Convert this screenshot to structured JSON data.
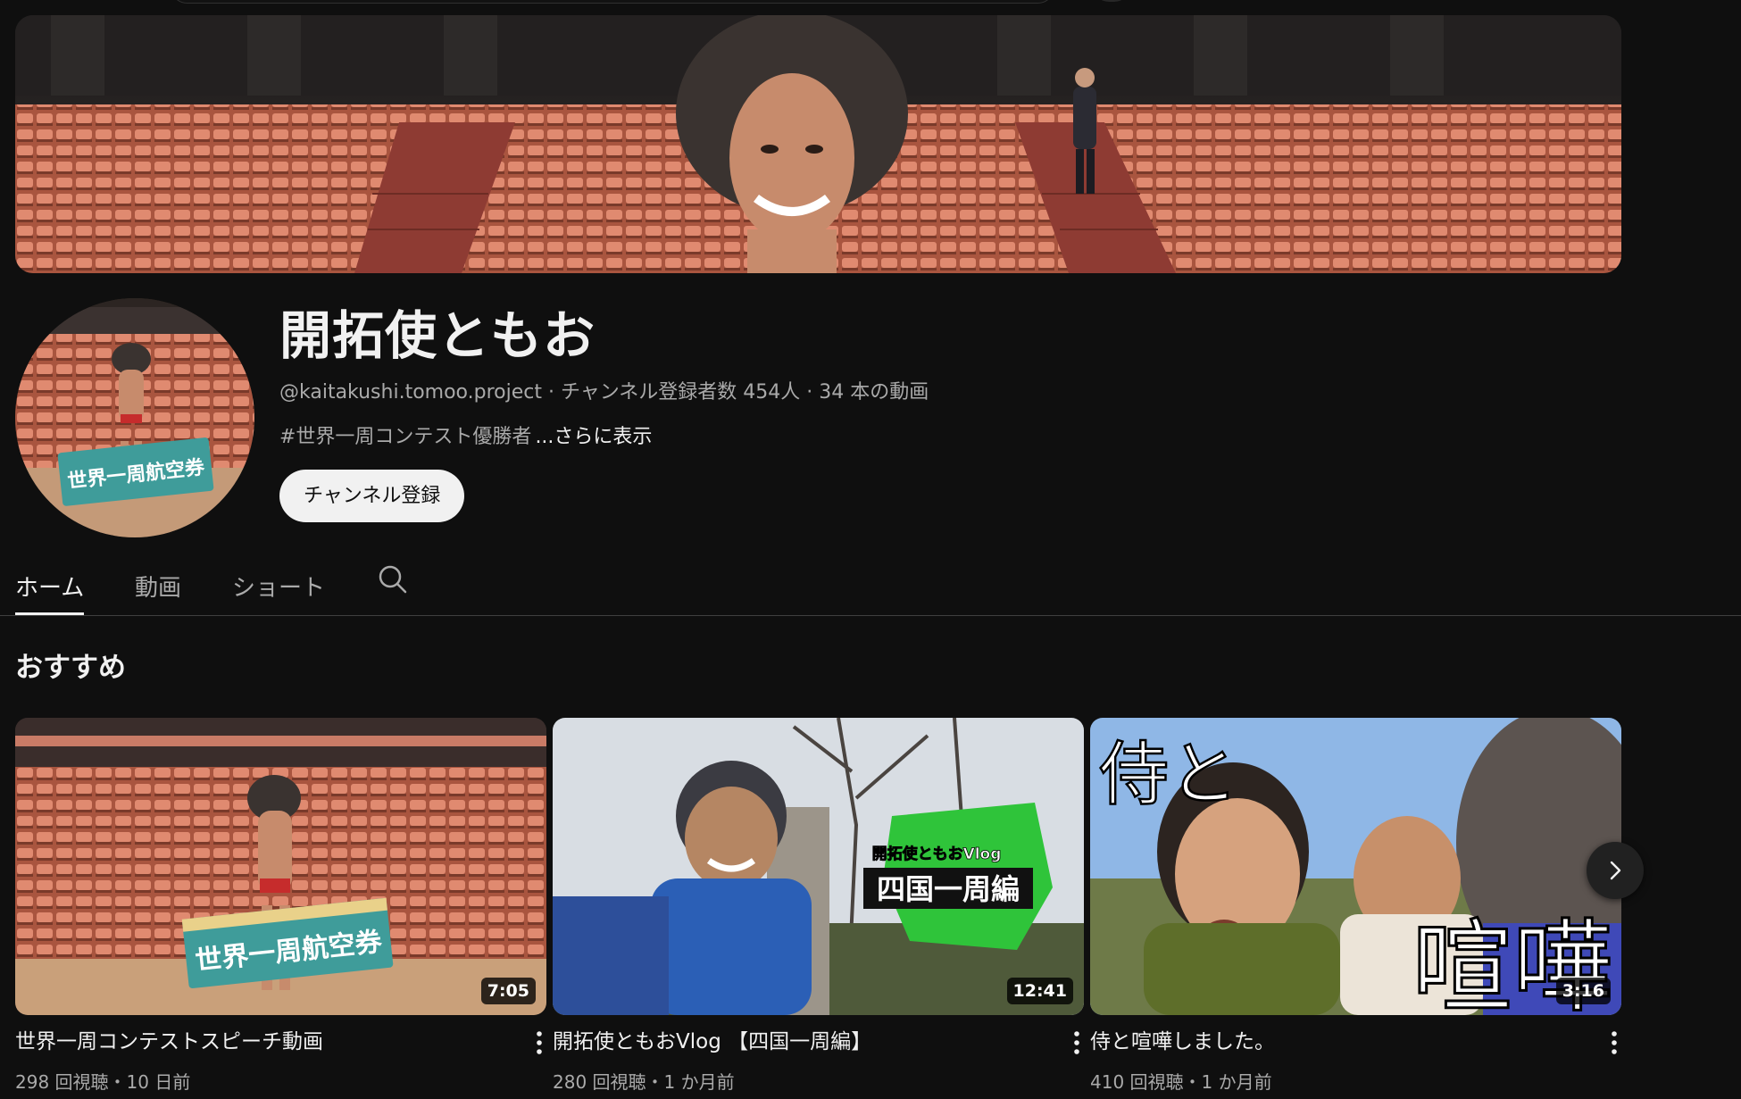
{
  "channel": {
    "name": "開拓使ともお",
    "handle": "@kaitakushi.tomoo.project",
    "subscribers": "チャンネル登録者数 454人",
    "video_count": "34 本の動画",
    "separator": " · ",
    "description": "#世界一周コンテスト優勝者",
    "more_label": "...さらに表示",
    "subscribe_label": "チャンネル登録"
  },
  "tabs": [
    {
      "label": "ホーム",
      "active": true
    },
    {
      "label": "動画",
      "active": false
    },
    {
      "label": "ショート",
      "active": false
    }
  ],
  "section": {
    "title": "おすすめ"
  },
  "videos": [
    {
      "title": "世界一周コンテストスピーチ動画",
      "meta": "298 回視聴・10 日前",
      "duration": "7:05"
    },
    {
      "title": "開拓使ともおVlog 【四国一周編】",
      "meta": "280 回視聴・1 か月前",
      "duration": "12:41"
    },
    {
      "title": "侍と喧嘩しました。",
      "meta": "410 回視聴・1 か月前",
      "duration": "3:16"
    }
  ],
  "thumb_text": {
    "v1_banner": "世界一周航空券",
    "v2_small": "開拓使ともおVlog",
    "v2_big": "四国一周編",
    "v3_top": "侍と",
    "v3_big": "喧嘩"
  },
  "avatar_text": "世界一周航空券",
  "icons": {
    "tab_search": "search-icon",
    "kebab": "more-vert-icon",
    "next": "chevron-right-icon"
  },
  "colors": {
    "background": "#0f0f0f",
    "text_primary": "#f1f1f1",
    "text_secondary": "#aaaaaa",
    "subscribe_bg": "#f1f1f1"
  }
}
